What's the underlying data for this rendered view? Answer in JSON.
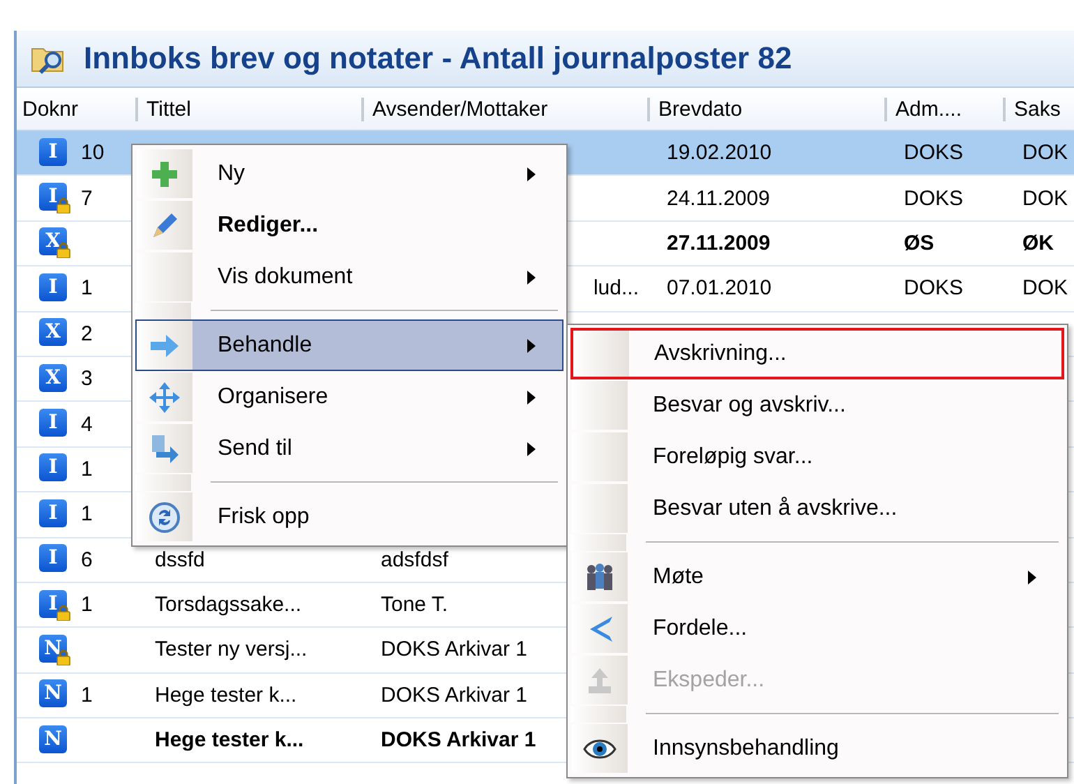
{
  "window": {
    "title": "Innboks brev og notater - Antall journalposter 82"
  },
  "table": {
    "columns": [
      "Doknr",
      "Tittel",
      "Avsender/Mottaker",
      "Brevdato",
      "Adm....",
      "Saks"
    ],
    "rows": [
      {
        "badge": "I",
        "locked": false,
        "doknr": "10",
        "selected": true,
        "bold": false,
        "brevdato": "19.02.2010",
        "adm": "DOKS",
        "saks": "DOK"
      },
      {
        "badge": "I",
        "locked": true,
        "doknr": "7",
        "selected": false,
        "bold": false,
        "brevdato": "24.11.2009",
        "adm": "DOKS",
        "saks": "DOK"
      },
      {
        "badge": "X",
        "locked": true,
        "selected": false,
        "bold": true,
        "brevdato": "27.11.2009",
        "adm": "ØS",
        "saks": "ØK"
      },
      {
        "badge": "I",
        "locked": false,
        "doknr": "1",
        "selected": false,
        "bold": false,
        "avsender": "lud...",
        "brevdato": "07.01.2010",
        "adm": "DOKS",
        "saks": "DOK"
      },
      {
        "badge": "X",
        "locked": false,
        "doknr": "2",
        "selected": false,
        "bold": false
      },
      {
        "badge": "X",
        "locked": false,
        "doknr": "3",
        "selected": false,
        "bold": false
      },
      {
        "badge": "I",
        "locked": false,
        "doknr": "4",
        "selected": false,
        "bold": false
      },
      {
        "badge": "I",
        "locked": false,
        "doknr": "1",
        "selected": false,
        "bold": false
      },
      {
        "badge": "I",
        "locked": false,
        "doknr": "1",
        "selected": false,
        "bold": false
      },
      {
        "badge": "I",
        "locked": false,
        "doknr": "6",
        "selected": false,
        "bold": false,
        "tittel": "dssfd",
        "avsender": "adsfdsf"
      },
      {
        "badge": "I",
        "locked": true,
        "doknr": "1",
        "selected": false,
        "bold": false,
        "tittel": "Torsdagssake...",
        "avsender": "Tone T."
      },
      {
        "badge": "N",
        "locked": true,
        "selected": false,
        "bold": false,
        "tittel": "Tester ny versj...",
        "avsender": "DOKS Arkivar 1"
      },
      {
        "badge": "N",
        "locked": false,
        "doknr": "1",
        "selected": false,
        "bold": false,
        "tittel": "Hege tester k...",
        "avsender": "DOKS Arkivar 1"
      },
      {
        "badge": "N",
        "locked": false,
        "selected": false,
        "bold": true,
        "tittel": "Hege tester k...",
        "avsender": "DOKS Arkivar 1"
      }
    ]
  },
  "context_menu": {
    "items": [
      {
        "kind": "item",
        "label": "Ny",
        "bold": false,
        "submenu": true,
        "selected": false
      },
      {
        "kind": "item",
        "label": "Rediger...",
        "bold": true,
        "submenu": false,
        "selected": false
      },
      {
        "kind": "item",
        "label": "Vis dokument",
        "bold": false,
        "submenu": true,
        "selected": false
      },
      {
        "kind": "separator"
      },
      {
        "kind": "item",
        "label": "Behandle",
        "bold": false,
        "submenu": true,
        "selected": true
      },
      {
        "kind": "item",
        "label": "Organisere",
        "bold": false,
        "submenu": true,
        "selected": false
      },
      {
        "kind": "item",
        "label": "Send til",
        "bold": false,
        "submenu": true,
        "selected": false
      },
      {
        "kind": "separator"
      },
      {
        "kind": "item",
        "label": "Frisk opp",
        "bold": false,
        "submenu": false,
        "selected": false
      }
    ]
  },
  "submenu": {
    "items": [
      {
        "kind": "item",
        "label": "Avskrivning...",
        "submenu": false,
        "disabled": false,
        "outlined": true
      },
      {
        "kind": "item",
        "label": "Besvar og avskriv...",
        "submenu": false,
        "disabled": false,
        "outlined": false
      },
      {
        "kind": "item",
        "label": "Foreløpig svar...",
        "submenu": false,
        "disabled": false,
        "outlined": false
      },
      {
        "kind": "item",
        "label": "Besvar uten å avskrive...",
        "submenu": false,
        "disabled": false,
        "outlined": false
      },
      {
        "kind": "separator"
      },
      {
        "kind": "item",
        "label": "Møte",
        "submenu": true,
        "disabled": false,
        "outlined": false
      },
      {
        "kind": "item",
        "label": "Fordele...",
        "submenu": false,
        "disabled": false,
        "outlined": false
      },
      {
        "kind": "item",
        "label": "Ekspeder...",
        "submenu": false,
        "disabled": true,
        "outlined": false
      },
      {
        "kind": "separator"
      },
      {
        "kind": "item",
        "label": "Innsynsbehandling",
        "submenu": false,
        "disabled": false,
        "outlined": false
      }
    ]
  }
}
